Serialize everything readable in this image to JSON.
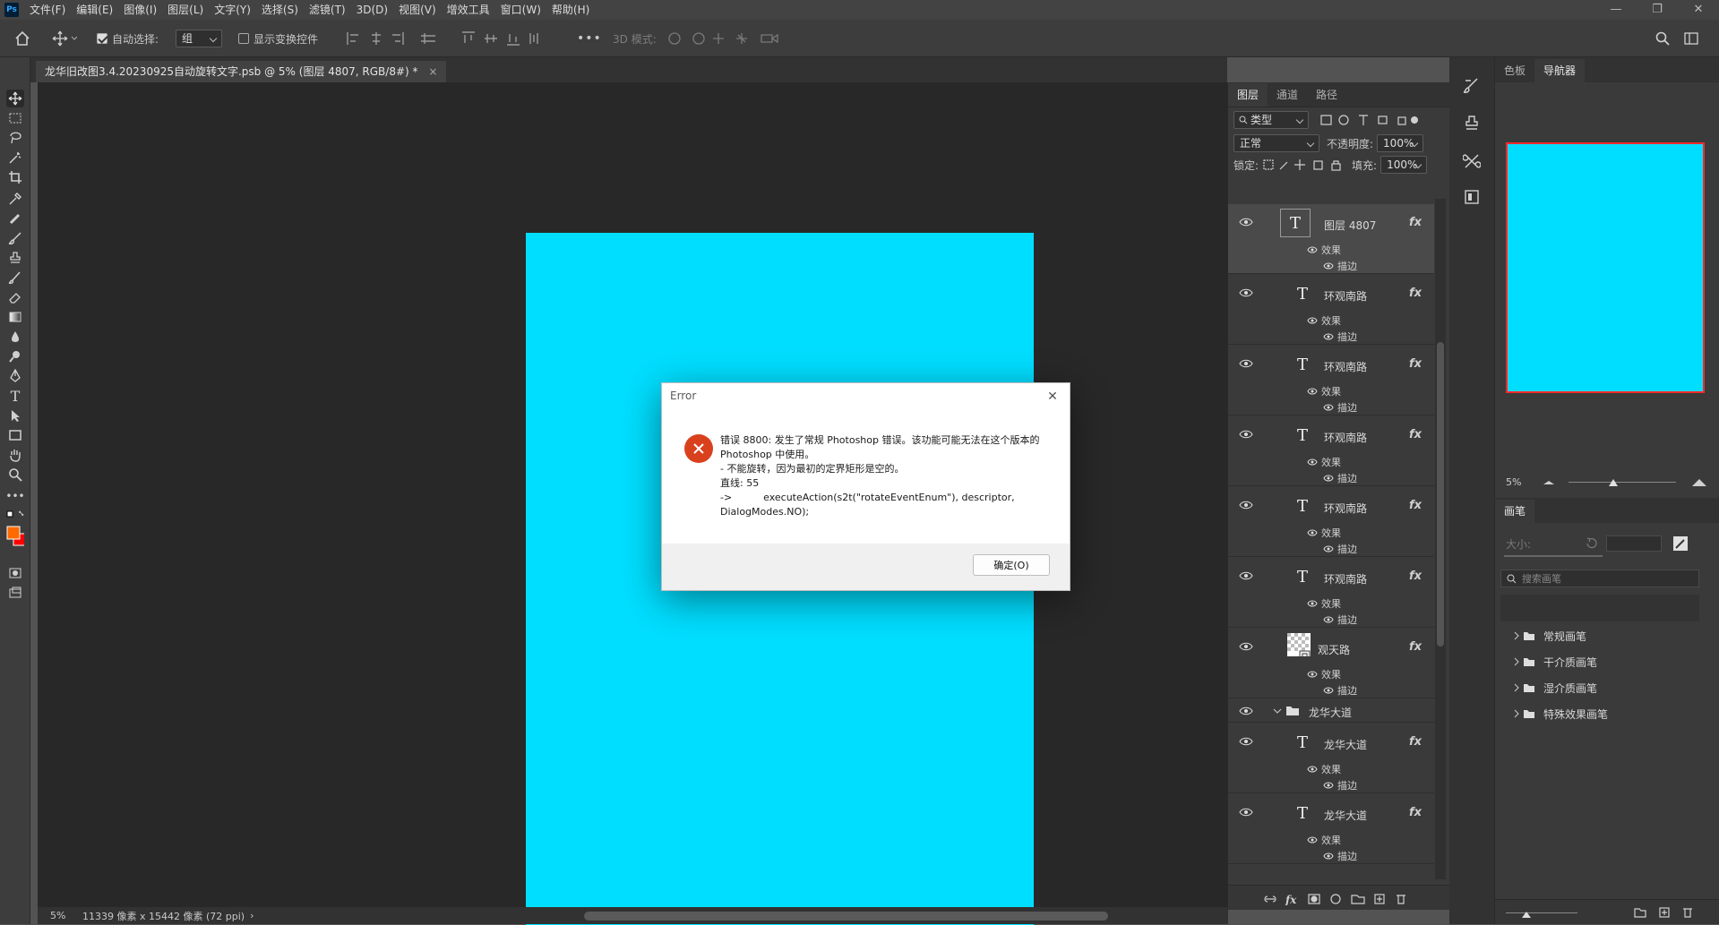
{
  "app": {
    "logo": "Ps"
  },
  "menu": [
    "文件(F)",
    "编辑(E)",
    "图像(I)",
    "图层(L)",
    "文字(Y)",
    "选择(S)",
    "滤镜(T)",
    "3D(D)",
    "视图(V)",
    "增效工具",
    "窗口(W)",
    "帮助(H)"
  ],
  "window_controls": [
    "—",
    "❐",
    "✕"
  ],
  "options_bar": {
    "auto_select_label": "自动选择:",
    "auto_select_value": "组",
    "show_transform_label": "显示变换控件",
    "more": "•••",
    "mode_3d_label": "3D 模式:"
  },
  "document": {
    "tab_title": "龙华旧改图3.4.20230925自动旋转文字.psb @ 5% (图层 4807, RGB/8#) *",
    "tab_close": "×",
    "canvas_color": "#00deff"
  },
  "status": {
    "zoom": "5%",
    "dimensions": "11339 像素 x 15442 像素 (72 ppi)",
    "arrow": "›"
  },
  "layers_panel": {
    "tabs": [
      "图层",
      "通道",
      "路径"
    ],
    "filter_kind": "类型",
    "blend_mode": "正常",
    "opacity_label": "不透明度:",
    "opacity_value": "100%",
    "lock_label": "锁定:",
    "fill_label": "填充:",
    "fill_value": "100%",
    "effects_label": "效果",
    "stroke_label": "描边",
    "fx_label": "fx",
    "layers": [
      {
        "name": "图层 4807",
        "type": "text",
        "selected": true
      },
      {
        "name": "环观南路",
        "type": "text"
      },
      {
        "name": "环观南路",
        "type": "text"
      },
      {
        "name": "环观南路",
        "type": "text"
      },
      {
        "name": "环观南路",
        "type": "text"
      },
      {
        "name": "环观南路",
        "type": "text"
      },
      {
        "name": "观天路",
        "type": "smart"
      },
      {
        "name": "龙华大道",
        "type": "group"
      },
      {
        "name": "龙华大道",
        "type": "text"
      },
      {
        "name": "龙华大道",
        "type": "text"
      }
    ]
  },
  "navigator": {
    "tabs": [
      "色板",
      "导航器"
    ],
    "zoom": "5%"
  },
  "brushes": {
    "tab": "画笔",
    "size_label": "大小:",
    "search_placeholder": "搜索画笔",
    "folders": [
      "常规画笔",
      "干介质画笔",
      "湿介质画笔",
      "特殊效果画笔"
    ]
  },
  "dialog": {
    "title": "Error",
    "message": "错误 8800: 发生了常规 Photoshop 错误。该功能可能无法在这个版本的\nPhotoshop 中使用。\n- 不能旋转，因为最初的定界矩形是空的。\n直线: 55\n->          executeAction(s2t(\"rotateEventEnum\"), descriptor,\nDialogModes.NO);",
    "ok_label": "确定(O)",
    "close": "✕",
    "icon_color": "#d9411e"
  }
}
